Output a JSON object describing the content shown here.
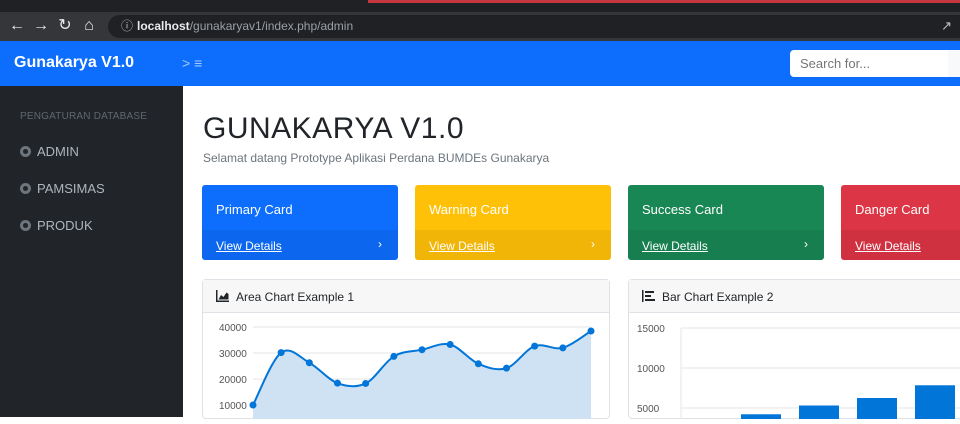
{
  "browser": {
    "url_host": "localhost",
    "url_path": "/gunakaryav1/index.php/admin",
    "info_icon": "info-icon",
    "share_icon": "share-icon"
  },
  "navbar": {
    "brand": "Gunakarya V1.0",
    "toggle_icon": "menu-toggle-icon",
    "search_placeholder": "Search for..."
  },
  "sidebar": {
    "heading": "PENGATURAN DATABASE",
    "items": [
      {
        "label": "ADMIN",
        "icon": "circle-icon"
      },
      {
        "label": "PAMSIMAS",
        "icon": "circle-icon"
      },
      {
        "label": "PRODUK",
        "icon": "circle-icon"
      }
    ]
  },
  "main": {
    "title": "GUNAKARYA V1.0",
    "subtitle": "Selamat datang Prototype Aplikasi Perdana BUMDEs Gunakarya",
    "cards": [
      {
        "title": "Primary Card",
        "link": "View Details",
        "color": "#0d6efd"
      },
      {
        "title": "Warning Card",
        "link": "View Details",
        "color": "#ffc107"
      },
      {
        "title": "Success Card",
        "link": "View Details",
        "color": "#198754"
      },
      {
        "title": "Danger Card",
        "link": "View Details",
        "color": "#dc3545"
      }
    ],
    "area_panel_title": "Area Chart Example 1",
    "bar_panel_title": "Bar Chart Example 2"
  },
  "chart_data": [
    {
      "type": "area",
      "title": "Area Chart Example 1",
      "ylim": [
        0,
        40000
      ],
      "y_ticks": [
        "40000",
        "30000",
        "20000",
        "10000"
      ],
      "values": [
        10000,
        30162,
        26263,
        18394,
        18287,
        28682,
        31274,
        33259,
        25849,
        24159,
        32651,
        31984,
        38451
      ],
      "line_color": "#0275d8",
      "fill_color": "#cfe2f4"
    },
    {
      "type": "bar",
      "title": "Bar Chart Example 2",
      "ylim": [
        0,
        15000
      ],
      "y_ticks": [
        "15000",
        "10000",
        "5000"
      ],
      "values": [
        4215,
        5312,
        6251,
        7841,
        9821
      ],
      "bar_color": "#0275d8"
    }
  ]
}
